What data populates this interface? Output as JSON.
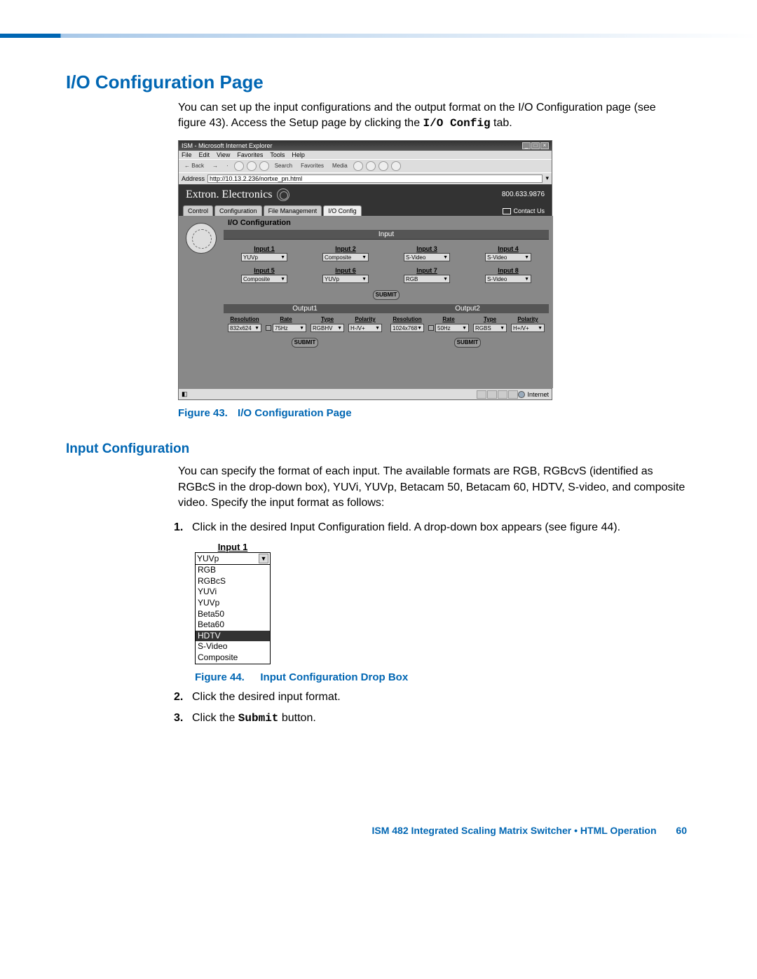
{
  "heading": "I/O Configuration Page",
  "intro_a": "You can set up the input configurations and the output format on the I/O Configuration page (see figure 43).  Access the Setup page by clicking the ",
  "intro_code": "I/O Config",
  "intro_b": " tab.",
  "browser": {
    "title": "ISM - Microsoft Internet Explorer",
    "menu": [
      "File",
      "Edit",
      "View",
      "Favorites",
      "Tools",
      "Help"
    ],
    "toolbar": {
      "back": "Back",
      "search": "Search",
      "favorites": "Favorites",
      "media": "Media"
    },
    "address_label": "Address",
    "address_value": "http://10.13.2.236/nortxe_pn.html",
    "brand": "Extron. Electronics",
    "phone": "800.633.9876",
    "tabs": [
      "Control",
      "Configuration",
      "File Management",
      "I/O Config"
    ],
    "active_tab": 3,
    "contact": "Contact Us",
    "panel_title": "I/O Configuration",
    "section_input": "Input",
    "inputs": [
      {
        "label": "Input 1",
        "value": "YUVp"
      },
      {
        "label": "Input 2",
        "value": "Composite"
      },
      {
        "label": "Input 3",
        "value": "S-Video"
      },
      {
        "label": "Input 4",
        "value": "S-Video"
      },
      {
        "label": "Input 5",
        "value": "Composite"
      },
      {
        "label": "Input 6",
        "value": "YUVp"
      },
      {
        "label": "Input 7",
        "value": "RGB"
      },
      {
        "label": "Input 8",
        "value": "S-Video"
      }
    ],
    "submit": "SUBMIT",
    "outputs": [
      {
        "title": "Output1",
        "cols": [
          "Resolution",
          "Rate",
          "Type",
          "Polarity"
        ],
        "vals": [
          "832x624",
          "75Hz",
          "RGBHV",
          "H-/V+"
        ]
      },
      {
        "title": "Output2",
        "cols": [
          "Resolution",
          "Rate",
          "Type",
          "Polarity"
        ],
        "vals": [
          "1024x768",
          "50Hz",
          "RGBS",
          "H+/V+"
        ]
      }
    ],
    "status_zone": "Internet"
  },
  "fig43": {
    "label": "Figure 43.",
    "text": "I/O Configuration Page"
  },
  "subheading": "Input Configuration",
  "inputconf_para": "You can specify the format of each input.  The available formats are RGB, RGBcvS (identified as RGBcS in the drop-down box), YUVi, YUVp, Betacam 50, Betacam 60, HDTV, S-video, and composite video.  Specify the input format as follows:",
  "step1": "Click in the desired Input Configuration field.  A drop-down box appears (see figure 44).",
  "dropdown": {
    "label": "Input 1",
    "selected": "YUVp",
    "highlight": "HDTV",
    "items": [
      "RGB",
      "RGBcS",
      "YUVi",
      "YUVp",
      "Beta50",
      "Beta60",
      "HDTV",
      "S-Video",
      "Composite"
    ]
  },
  "fig44": {
    "label": "Figure 44.",
    "text": "Input Configuration Drop Box"
  },
  "step2": "Click the desired input format.",
  "step3a": "Click the ",
  "step3code": "Submit",
  "step3b": " button.",
  "footer": {
    "text": "ISM 482 Integrated Scaling Matrix Switcher • HTML Operation",
    "page": "60"
  }
}
